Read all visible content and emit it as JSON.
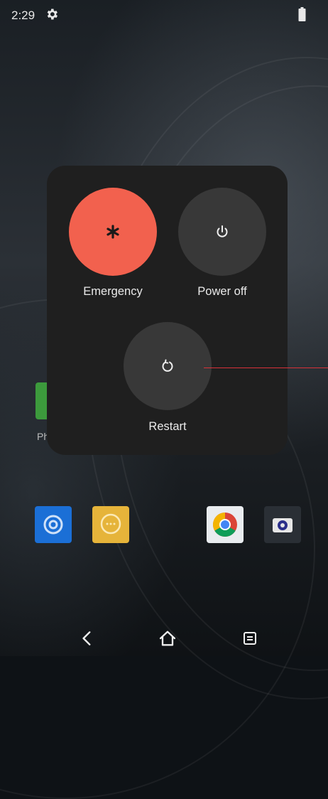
{
  "status_bar": {
    "time": "2:29",
    "settings_icon": "gear-icon",
    "battery_icon": "battery-icon"
  },
  "home_screen": {
    "phone_label": "Ph",
    "apps": [
      "phone-icon",
      "settings-icon",
      "messages-icon",
      "chrome-icon",
      "camera-icon"
    ]
  },
  "power_menu": {
    "emergency": {
      "label": "Emergency",
      "icon": "asterisk-icon",
      "color": "#f2614e"
    },
    "power_off": {
      "label": "Power off",
      "icon": "power-icon",
      "color": "#383838"
    },
    "restart": {
      "label": "Restart",
      "icon": "restart-icon",
      "color": "#383838"
    },
    "background": "#1f1f1f"
  },
  "nav_bar": {
    "back_icon": "back-icon",
    "home_icon": "home-icon",
    "recents_icon": "recents-icon"
  },
  "annotation_color": "#d8323a"
}
